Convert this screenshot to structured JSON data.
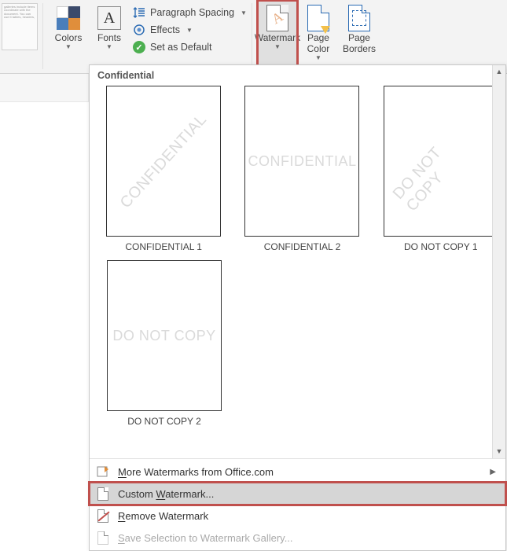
{
  "ribbon": {
    "doc_preview_text": "galleries include items coordinate with the document. You can use it tables, headers,",
    "colors_label": "Colors",
    "fonts_label": "Fonts",
    "para_spacing_label": "Paragraph Spacing",
    "effects_label": "Effects",
    "default_label": "Set as Default",
    "watermark_label": "Watermark",
    "page_color_label": "Page\nColor",
    "page_borders_label": "Page\nBorders"
  },
  "dropdown": {
    "category": "Confidential",
    "items": [
      {
        "text": "CONFIDENTIAL",
        "caption": "CONFIDENTIAL 1",
        "diagonal": true
      },
      {
        "text": "CONFIDENTIAL",
        "caption": "CONFIDENTIAL 2",
        "diagonal": false
      },
      {
        "text": "DO NOT COPY",
        "caption": "DO NOT COPY 1",
        "diagonal": true
      },
      {
        "text": "DO NOT COPY",
        "caption": "DO NOT COPY 2",
        "diagonal": false
      }
    ],
    "more_label": "More Watermarks from Office.com",
    "custom_label": "Custom Watermark...",
    "remove_label": "Remove Watermark",
    "save_label": "Save Selection to Watermark Gallery..."
  }
}
